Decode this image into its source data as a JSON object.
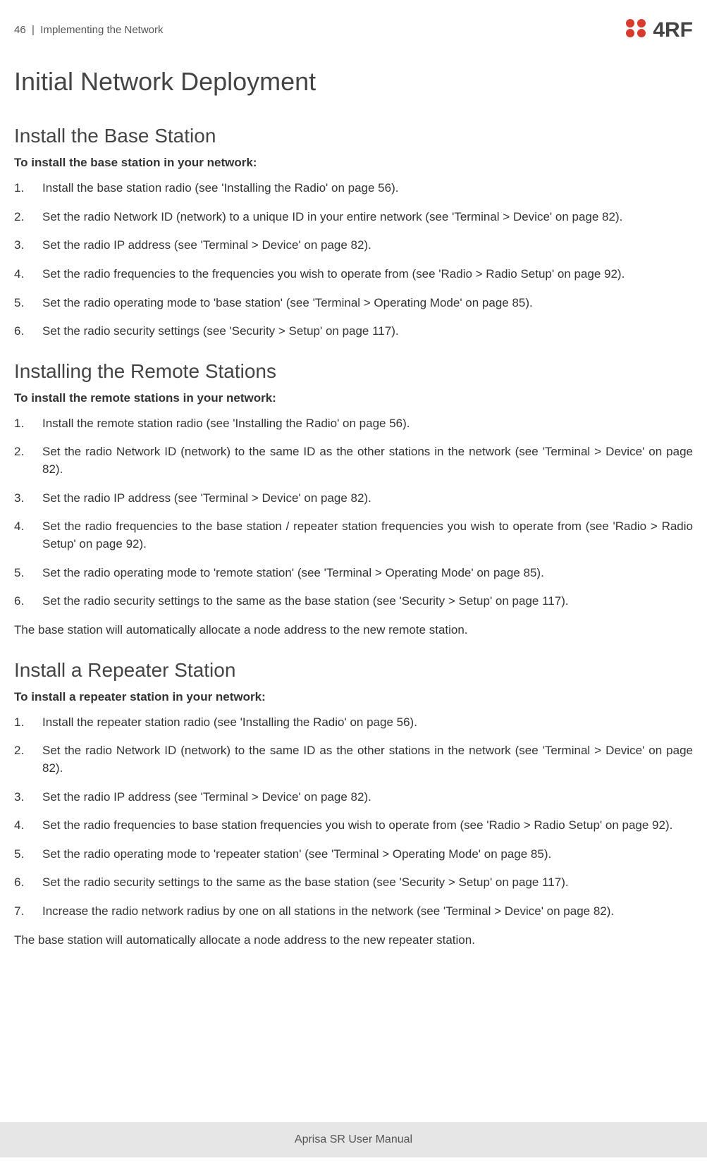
{
  "header": {
    "page_num": "46",
    "separator": "|",
    "section_name": "Implementing the Network",
    "logo_text": "4RF"
  },
  "h1": "Initial Network Deployment",
  "sections": [
    {
      "title": "Install the Base Station",
      "lead": "To install the base station in your network:",
      "items": [
        "Install the base station radio (see 'Installing the Radio' on page 56).",
        "Set the radio Network ID (network) to a unique ID in your entire network (see 'Terminal > Device' on page 82).",
        "Set the radio IP address (see 'Terminal > Device' on page 82).",
        "Set the radio frequencies to the frequencies you wish to operate from (see 'Radio > Radio Setup' on page 92).",
        "Set the radio operating mode to 'base station' (see 'Terminal > Operating Mode' on page 85).",
        "Set the radio security settings (see 'Security > Setup' on page 117)."
      ],
      "trailing": null
    },
    {
      "title": "Installing the Remote Stations",
      "lead": "To install the remote stations in your network:",
      "items": [
        "Install the remote station radio (see 'Installing the Radio' on page 56).",
        "Set the radio Network ID (network) to the same ID as the other stations in the network (see 'Terminal > Device' on page 82).",
        "Set the radio IP address (see 'Terminal > Device' on page 82).",
        "Set the radio frequencies to the base station / repeater station frequencies you wish to operate from (see 'Radio > Radio Setup' on page 92).",
        "Set the radio operating mode to 'remote station' (see 'Terminal > Operating Mode' on page 85).",
        "Set the radio security settings to the same as the base station (see 'Security > Setup' on page 117)."
      ],
      "trailing": "The base station will automatically allocate a node address to the new remote station."
    },
    {
      "title": "Install a Repeater Station",
      "lead": "To install a repeater station in your network:",
      "items": [
        "Install the repeater station radio (see 'Installing the Radio' on page 56).",
        "Set the radio Network ID (network) to the same ID as the other stations in the network (see 'Terminal > Device' on page 82).",
        "Set the radio IP address (see 'Terminal > Device' on page 82).",
        "Set the radio frequencies to base station frequencies you wish to operate from (see 'Radio > Radio Setup' on page 92).",
        "Set the radio operating mode to 'repeater station' (see 'Terminal > Operating Mode' on page 85).",
        "Set the radio security settings to the same as the base station (see 'Security > Setup' on page 117).",
        "Increase the radio network radius by one on all stations in the network (see 'Terminal > Device' on page 82)."
      ],
      "trailing": "The base station will automatically allocate a node address to the new repeater station."
    }
  ],
  "footer": "Aprisa SR User Manual"
}
